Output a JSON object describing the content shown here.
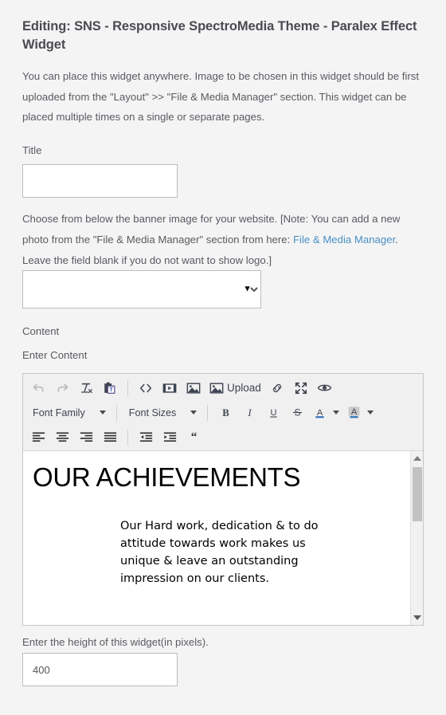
{
  "page": {
    "title": "Editing: SNS - Responsive SpectroMedia Theme - Paralex Effect Widget",
    "description": "You can place this widget anywhere. Image to be chosen in this widget should be first uploaded from the \"Layout\" >> \"File & Media Manager\" section. This widget can be placed multiple times on a single or separate pages.",
    "background_color": "#f4f4f4"
  },
  "title_field": {
    "label": "Title",
    "value": "",
    "placeholder": ""
  },
  "banner": {
    "note_part1": "Choose from below the banner image for your website. [Note: You can add a new photo from the \"File & Media Manager\" section from here: ",
    "link_text": "File & Media Manager",
    "note_part2": ". Leave the field blank if you do not want to show logo.]",
    "link_color": "#4a90c4",
    "select_value": "",
    "select_options": [
      ""
    ],
    "dropdown_arrow": "chevron-down-icon"
  },
  "content": {
    "label": "Content",
    "sub_label": "Enter Content"
  },
  "toolbar": {
    "row1": [
      {
        "name": "undo-icon",
        "tooltip": "Undo",
        "disabled": true
      },
      {
        "name": "redo-icon",
        "tooltip": "Redo",
        "disabled": true
      },
      {
        "name": "clear-formatting-icon",
        "tooltip": "Clear formatting",
        "disabled": false
      },
      {
        "name": "paste-as-text-icon",
        "tooltip": "Paste as text",
        "disabled": false
      },
      {
        "name": "source-code-icon",
        "tooltip": "Source code",
        "disabled": false
      },
      {
        "name": "insert-media-icon",
        "tooltip": "Insert/edit media",
        "disabled": false
      },
      {
        "name": "insert-image-icon",
        "tooltip": "Insert/edit image",
        "disabled": false
      },
      {
        "name": "upload-icon",
        "tooltip": "Upload",
        "disabled": false
      },
      {
        "name": "insert-link-icon",
        "tooltip": "Insert/edit link",
        "disabled": false
      },
      {
        "name": "fullscreen-icon",
        "tooltip": "Fullscreen",
        "disabled": false
      },
      {
        "name": "preview-icon",
        "tooltip": "Preview",
        "disabled": false
      }
    ],
    "upload_label": "Upload",
    "font_family_label": "Font Family",
    "font_sizes_label": "Font Sizes",
    "row2": [
      {
        "name": "bold-icon",
        "glyph": "B"
      },
      {
        "name": "italic-icon",
        "glyph": "I"
      },
      {
        "name": "underline-icon",
        "glyph": "U"
      },
      {
        "name": "strikethrough-icon",
        "glyph": "S"
      },
      {
        "name": "text-color-icon",
        "glyph": "A"
      },
      {
        "name": "background-color-icon",
        "glyph": "A"
      }
    ],
    "row3": [
      {
        "name": "align-left-icon"
      },
      {
        "name": "align-center-icon"
      },
      {
        "name": "align-right-icon"
      },
      {
        "name": "align-justify-icon"
      },
      {
        "name": "outdent-icon"
      },
      {
        "name": "indent-icon"
      },
      {
        "name": "blockquote-icon"
      }
    ]
  },
  "editor_content": {
    "heading": "OUR ACHIEVEMENTS",
    "paragraph": "Our Hard work, dedication & to do attitude towards work makes us unique & leave an outstanding impression on our clients."
  },
  "height_field": {
    "label": "Enter the height of this widget(in pixels).",
    "value": "400"
  }
}
